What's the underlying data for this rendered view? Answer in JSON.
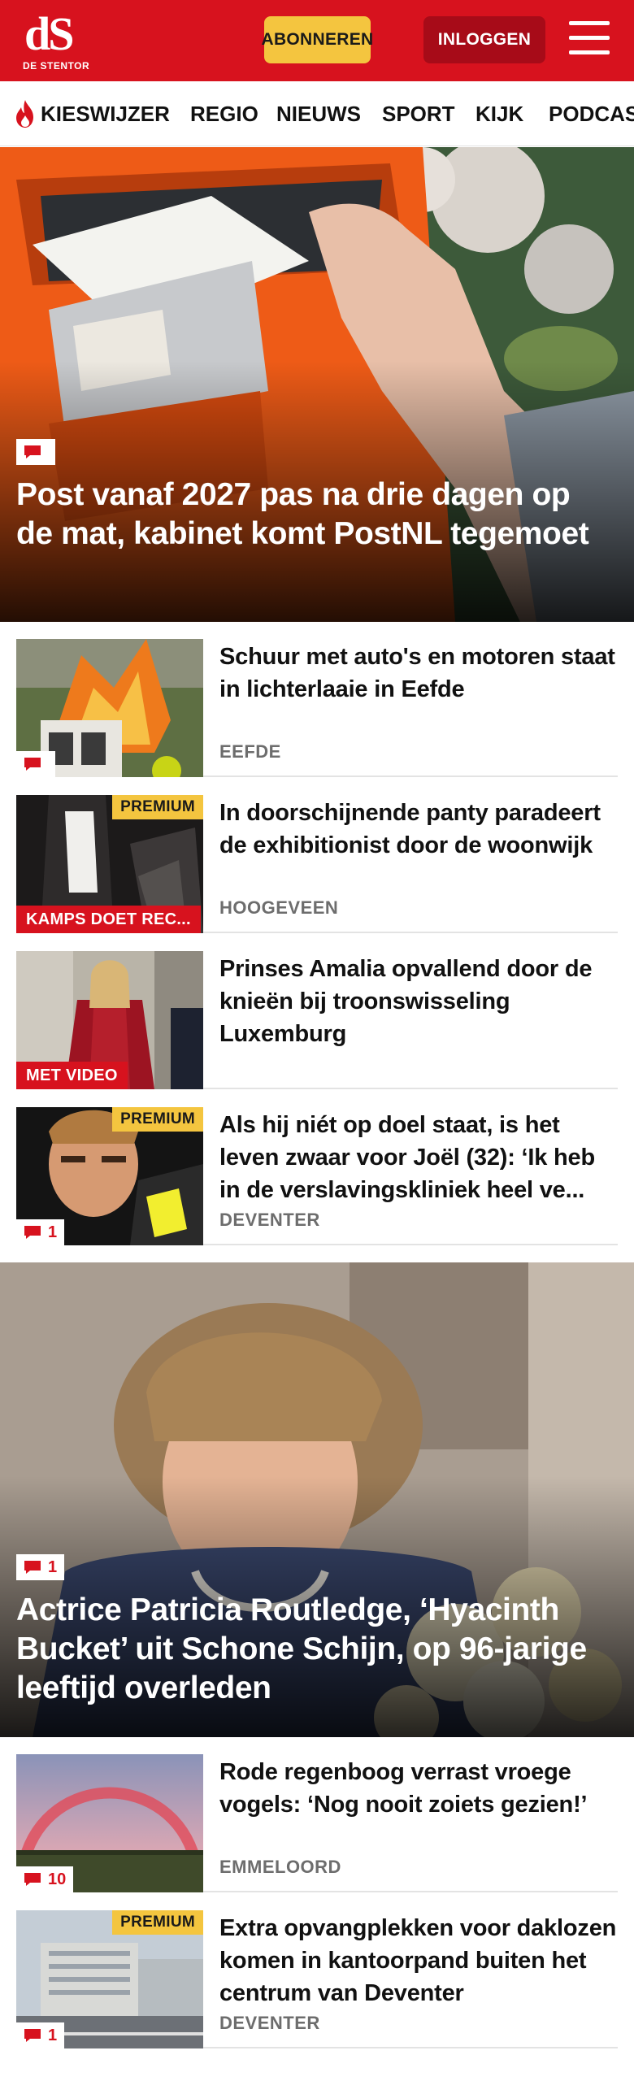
{
  "header": {
    "logo_mark": "dS",
    "logo_sub": "DE STENTOR",
    "subscribe_label": "ABONNEREN",
    "login_label": "INLOGGEN",
    "accent_color": "#d7121e",
    "subscribe_color": "#f4c53f"
  },
  "nav": {
    "items": [
      {
        "label": "KIESWIJZER",
        "icon": "flame-icon"
      },
      {
        "label": "REGIO"
      },
      {
        "label": "NIEUWS"
      },
      {
        "label": "SPORT"
      },
      {
        "label": "KIJK"
      },
      {
        "label": "PODCAS"
      }
    ]
  },
  "hero1": {
    "title": "Post vanaf 2027 pas na drie dagen op de mat, kabinet komt PostNL tegemoet",
    "comments": ""
  },
  "list1": [
    {
      "title": "Schuur met auto's en motoren staat in lichterlaaie in Eefde",
      "location": "EEFDE",
      "comments": "",
      "premium": "",
      "label": ""
    },
    {
      "title": "In doorschijnende panty paradeert de exhibitionist door de woonwijk",
      "location": "HOOGEVEEN",
      "comments": "",
      "premium": "PREMIUM",
      "label": "KAMPS DOET REC..."
    },
    {
      "title": "Prinses Amalia opvallend door de knieën bij troonswisseling Luxemburg",
      "location": "",
      "comments": "",
      "premium": "",
      "label": "MET VIDEO"
    },
    {
      "title": "Als hij niét op doel staat, is het leven zwaar voor Joël (32): ‘Ik heb in de verslavingskliniek heel ve...",
      "location": "DEVENTER",
      "comments": "1",
      "premium": "PREMIUM",
      "label": ""
    }
  ],
  "hero2": {
    "title": "Actrice Patricia Routledge, ‘Hyacinth Bucket’ uit Schone Schijn, op 96-jarige leeftijd overleden",
    "comments": "1"
  },
  "list2": [
    {
      "title": "Rode regenboog verrast vroege vogels: ‘Nog nooit zoiets gezien!’",
      "location": "EMMELOORD",
      "comments": "10",
      "premium": "",
      "label": ""
    },
    {
      "title": "Extra opvangplekken voor daklozen komen in kantoorpand buiten het centrum van Deventer",
      "location": "DEVENTER",
      "comments": "1",
      "premium": "PREMIUM",
      "label": ""
    }
  ]
}
